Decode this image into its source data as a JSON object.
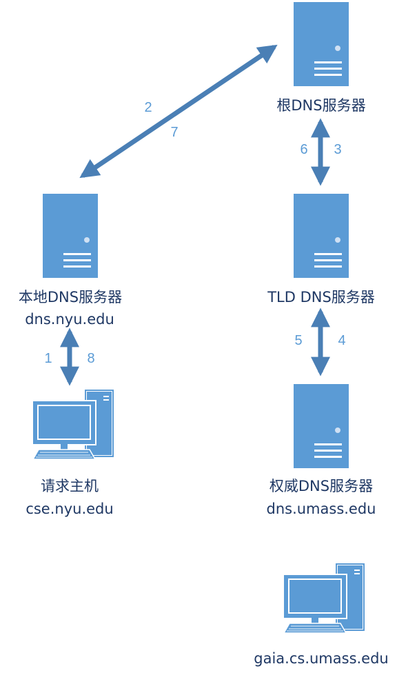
{
  "nodes": {
    "root": {
      "title": "根DNS服务器",
      "host": ""
    },
    "local": {
      "title": "本地DNS服务器",
      "host": "dns.nyu.edu"
    },
    "tld": {
      "title": "TLD DNS服务器",
      "host": ""
    },
    "requester": {
      "title": "请求主机",
      "host": "cse.nyu.edu"
    },
    "auth": {
      "title": "权威DNS服务器",
      "host": "dns.umass.edu"
    },
    "target": {
      "title": "",
      "host": "gaia.cs.umass.edu"
    }
  },
  "steps": {
    "s1": "1",
    "s2": "2",
    "s3": "3",
    "s4": "4",
    "s5": "5",
    "s6": "6",
    "s7": "7",
    "s8": "8"
  },
  "colors": {
    "server": "#5b9bd5",
    "arrow": "#4a7fb5",
    "label": "#1f3864",
    "step": "#5b9bd5"
  }
}
